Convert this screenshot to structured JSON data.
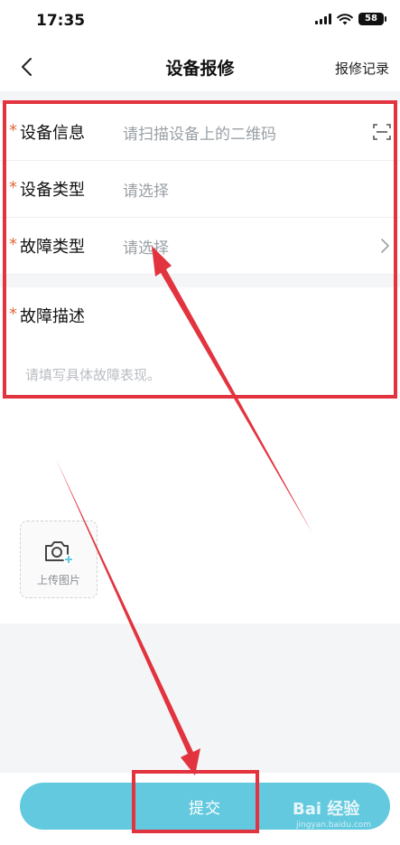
{
  "status_bar": {
    "time": "17:35",
    "battery": "58",
    "icons": [
      "signal-icon",
      "wifi-icon",
      "battery-icon"
    ]
  },
  "nav": {
    "title": "设备报修",
    "right_link": "报修记录",
    "back_icon": "chevron-left-icon"
  },
  "form": {
    "required_mark": "*",
    "rows": [
      {
        "label": "设备信息",
        "placeholder": "请扫描设备上的二维码",
        "trailing_icon": "scan-icon"
      },
      {
        "label": "设备类型",
        "placeholder": "请选择"
      },
      {
        "label": "故障类型",
        "placeholder": "请选择",
        "trailing_icon": "chevron-right-icon"
      }
    ],
    "description": {
      "label": "故障描述",
      "placeholder": "请填写具体故障表现。"
    }
  },
  "upload": {
    "label": "上传图片",
    "icon": "camera-plus-icon"
  },
  "submit": {
    "label": "提交"
  },
  "watermark": {
    "text": "Bai 经验",
    "sub": "jingyan.baidu.com"
  },
  "colors": {
    "accent": "#63c9df",
    "required": "#e46a3a",
    "placeholder": "#9aa0a6",
    "annotation": "#e2343f",
    "background_grey": "#f4f5f7"
  }
}
